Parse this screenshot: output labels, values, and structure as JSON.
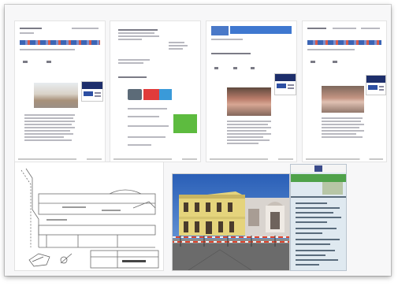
{
  "collage": {
    "pages": [
      {
        "kind": "news-article-ruins"
      },
      {
        "kind": "letter-with-ads"
      },
      {
        "kind": "news-article-interior"
      },
      {
        "kind": "news-article-interior"
      }
    ],
    "drawing": {
      "kind": "architectural-section-drawing"
    },
    "photo": {
      "kind": "villa-facade-with-construction-barriers"
    },
    "poster": {
      "kind": "building-site-notice-board"
    }
  },
  "colors": {
    "banner_blue": "#3b65b5",
    "banner_red": "#d65a4e",
    "ad_navy": "#1d2e6b",
    "sky": "#2f6fc6",
    "villa_wall": "#e5d47c",
    "barrier": "#e0452c",
    "poster_green": "#4fa24a"
  }
}
